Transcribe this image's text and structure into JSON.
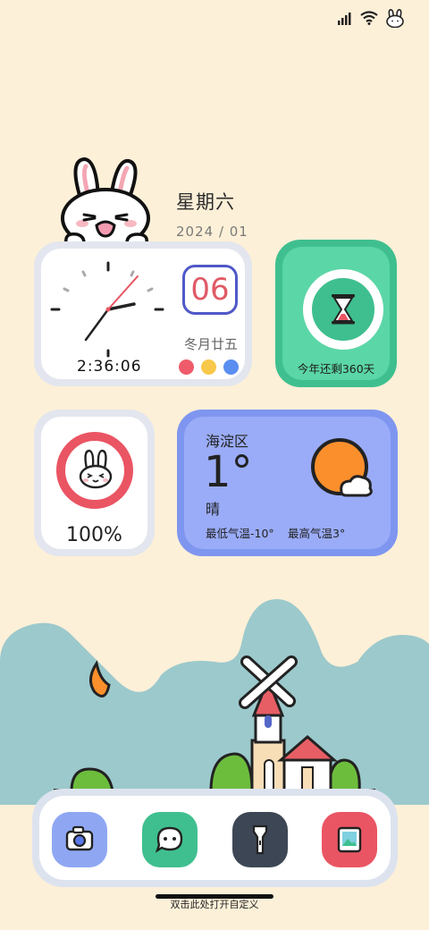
{
  "status_bar": {
    "icons": [
      "signal-icon",
      "wifi-icon",
      "bunny-icon"
    ]
  },
  "date": {
    "weekday": "星期六",
    "year_month": "2024 / 01"
  },
  "clock_widget": {
    "time": "2:36:06",
    "day": "06",
    "lunar": "冬月廿五",
    "dot_colors": [
      "#ef5b6a",
      "#f7c84a",
      "#5a8ef0"
    ]
  },
  "year_widget": {
    "text": "今年还剩360天",
    "icon": "hourglass-icon"
  },
  "battery_widget": {
    "percent": "100%",
    "level": 1.0,
    "icon": "bunny-face-icon"
  },
  "weather_widget": {
    "location": "海淀区",
    "temp": "1°",
    "condition": "晴",
    "low": "最低气温-10°",
    "high": "最高气温3°",
    "icon": "sun-cloud-icon"
  },
  "dock": {
    "apps": [
      "camera-icon",
      "chat-icon",
      "flashlight-icon",
      "gallery-icon"
    ]
  },
  "hint": "双击此处打开自定义",
  "colors": {
    "background": "#fdf0d8",
    "hill": "#9cc9cc",
    "accent_green": "#5bd6a6",
    "accent_blue": "#9aacf8",
    "accent_red": "#ef5b6a"
  }
}
